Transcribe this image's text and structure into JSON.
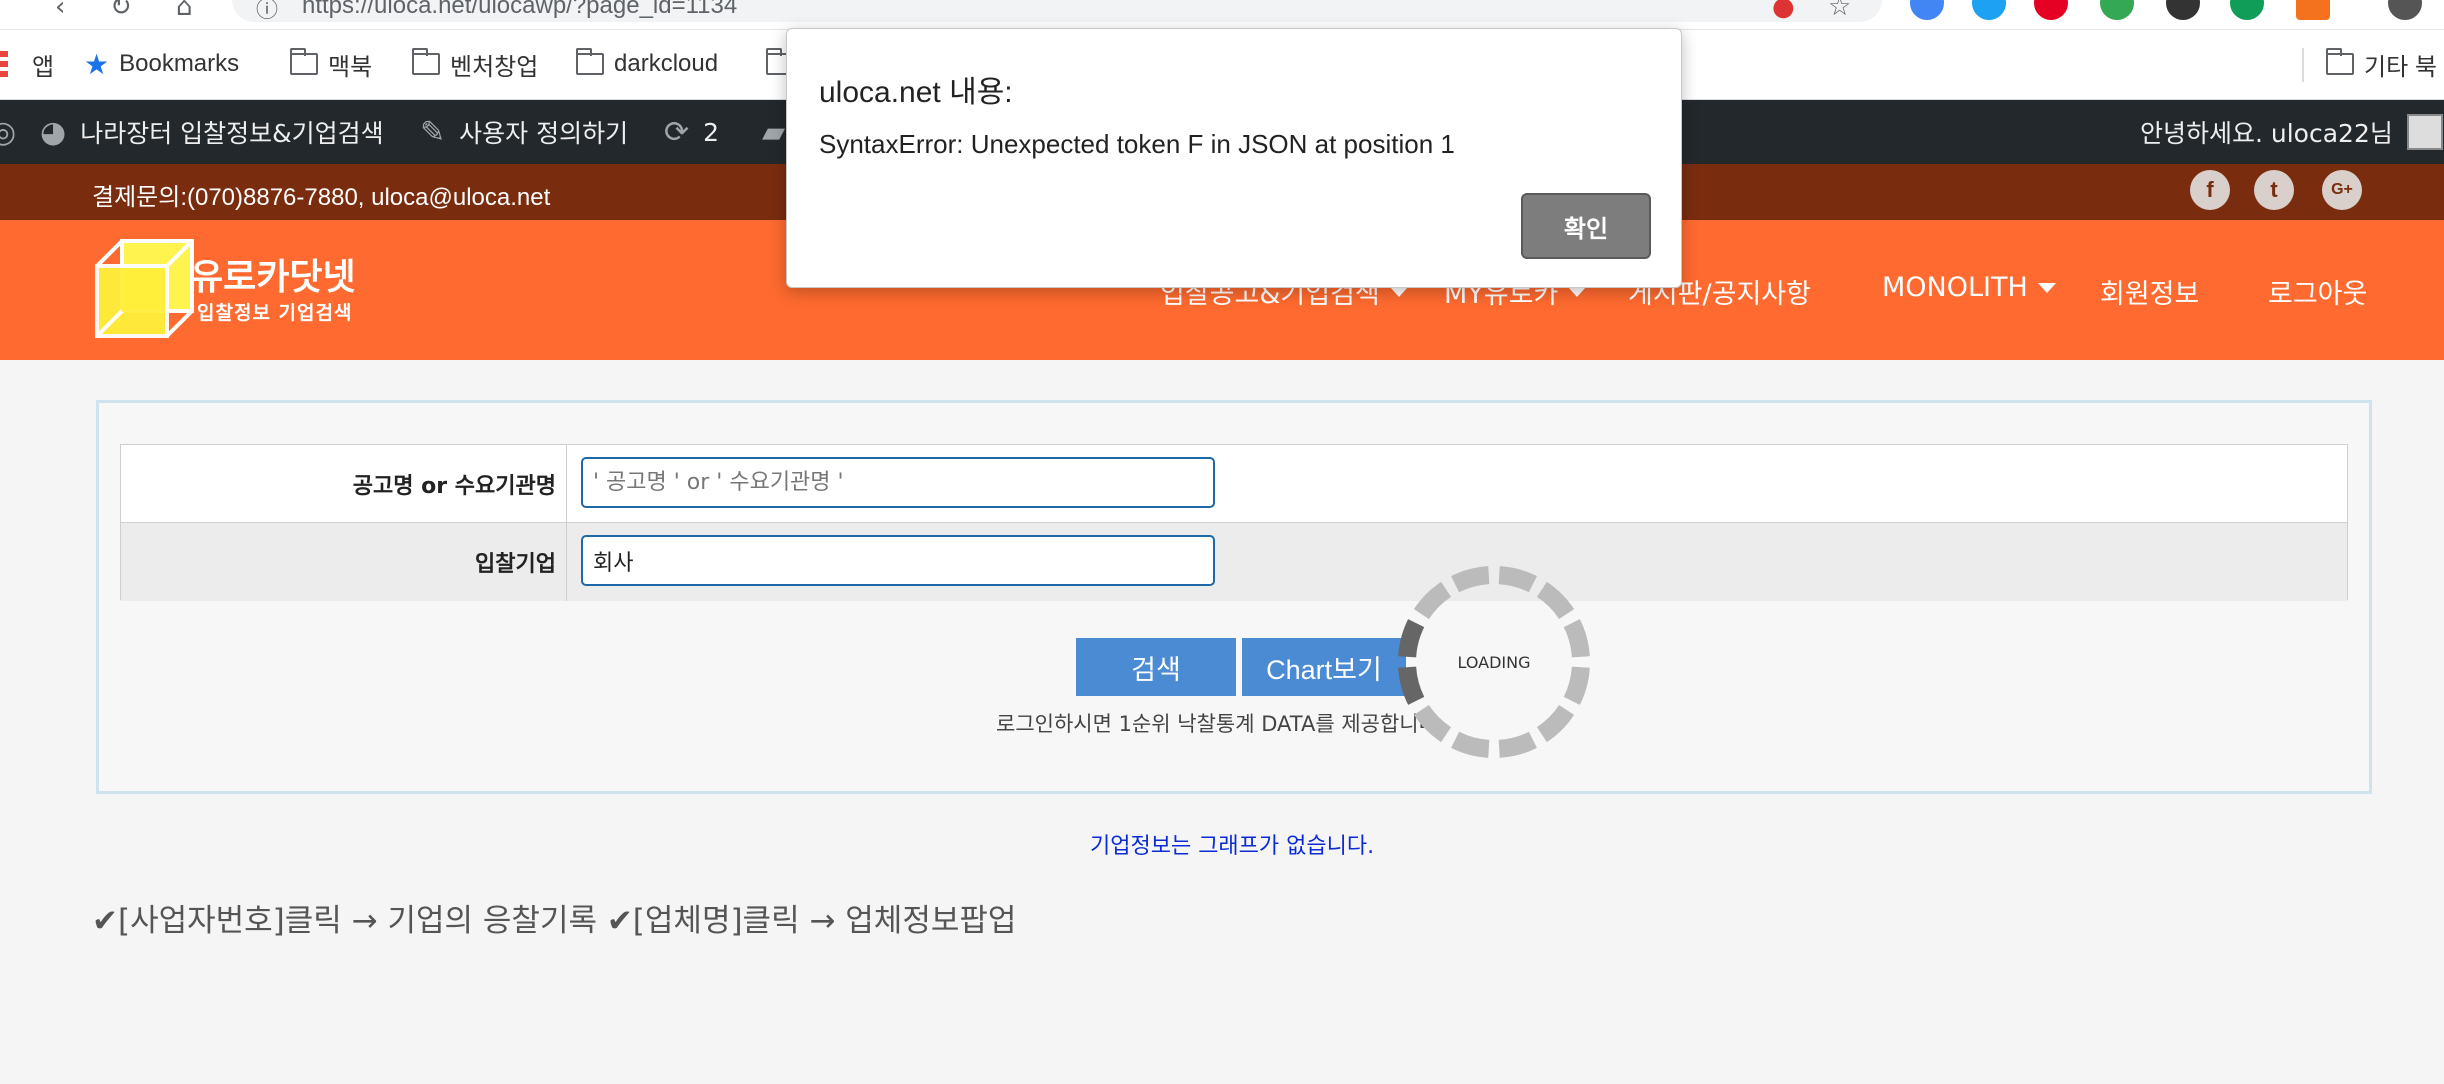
{
  "browser": {
    "url": "https://uloca.net/ulocawp/?page_id=1134",
    "bookmarks": [
      {
        "label": "앱"
      },
      {
        "label": "Bookmarks"
      },
      {
        "label": "맥북"
      },
      {
        "label": "벤처창업"
      },
      {
        "label": "darkcloud"
      },
      {
        "label": "기타 북"
      }
    ]
  },
  "adminbar": {
    "site_name": "나라장터 입찰정보&기업검색",
    "customize": "사용자 정의하기",
    "updates_count": "2",
    "greeting": "안녕하세요. uloca22님"
  },
  "topbar": {
    "contact": "결제문의:(070)8876-7880, uloca@uloca.net",
    "social": [
      "f",
      "t",
      "G+"
    ]
  },
  "header": {
    "logo_title": "유로카닷넷",
    "logo_subtitle": "입찰정보 기업검색",
    "nav": [
      {
        "label": "입찰공고&기업검색",
        "dropdown": true
      },
      {
        "label": "MY유로카",
        "dropdown": true
      },
      {
        "label": "게시판/공지사항",
        "dropdown": false
      },
      {
        "label": "MONOLITH",
        "dropdown": true
      },
      {
        "label": "회원정보",
        "dropdown": false
      },
      {
        "label": "로그아웃",
        "dropdown": false
      }
    ]
  },
  "search": {
    "rows": [
      {
        "label": "공고명 or 수요기관명",
        "value": "",
        "placeholder": "' 공고명 ' or ' 수요기관명 '"
      },
      {
        "label": "입찰기업",
        "value": "회사",
        "placeholder": ""
      }
    ],
    "search_button": "검색",
    "chart_button": "Chart보기",
    "info_text": "로그인하시면 1순위 낙찰통계 DATA를 제공합니다.",
    "loading_text": "LOADING"
  },
  "graph_note": "기업정보는 그래프가 없습니다.",
  "tip": "✔[사업자번호]클릭 → 기업의 응찰기록 ✔[업체명]클릭 → 업체정보팝업",
  "dialog": {
    "title": "uloca.net 내용:",
    "message": "SyntaxError: Unexpected token F in JSON at position 1",
    "ok_button": "확인"
  }
}
